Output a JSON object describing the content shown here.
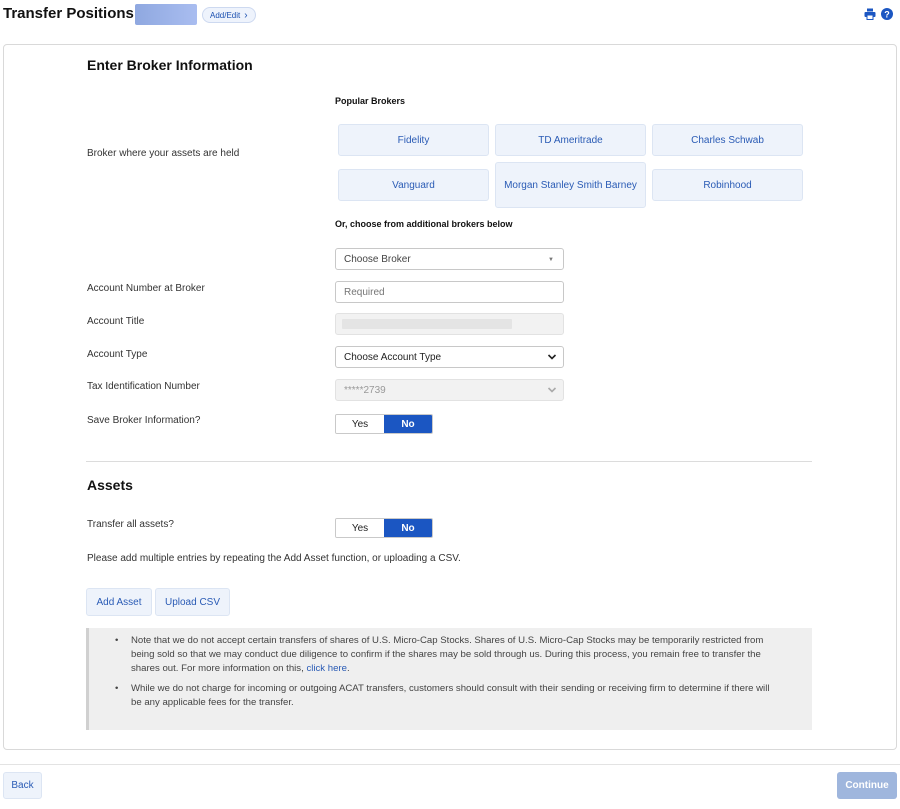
{
  "header": {
    "title": "Transfer Positions",
    "add_edit_label": "Add/Edit",
    "print_icon": "print-icon",
    "help_icon": "question-circle-icon"
  },
  "broker_section": {
    "heading": "Enter Broker Information",
    "popular_label": "Popular Brokers",
    "broker_label": "Broker where your assets are held",
    "brokers": [
      "Fidelity",
      "TD Ameritrade",
      "Charles Schwab",
      "Vanguard",
      "Morgan Stanley Smith Barney",
      "Robinhood"
    ],
    "additional_label": "Or, choose from additional brokers below",
    "choose_broker": "Choose Broker",
    "fields": {
      "account_number": {
        "label": "Account Number at Broker",
        "placeholder": "Required"
      },
      "account_title": {
        "label": "Account Title"
      },
      "account_type": {
        "label": "Account Type",
        "value": "Choose Account Type"
      },
      "tax_id": {
        "label": "Tax Identification Number",
        "value": "*****2739"
      }
    },
    "save_label": "Save Broker Information?",
    "save_toggle": {
      "yes": "Yes",
      "no": "No",
      "selected": "No"
    }
  },
  "assets_section": {
    "heading": "Assets",
    "transfer_all_label": "Transfer all assets?",
    "transfer_toggle": {
      "yes": "Yes",
      "no": "No",
      "selected": "No"
    },
    "instructions": "Please add multiple entries by repeating the Add Asset function, or uploading a CSV.",
    "add_asset": "Add Asset",
    "upload_csv": "Upload CSV",
    "notes": {
      "note1": "Note that we do not accept certain transfers of shares of U.S. Micro-Cap Stocks. Shares of U.S. Micro-Cap Stocks may be temporarily restricted from being sold so that we may conduct due diligence to confirm if the shares may be sold through us. During this process, you remain free to transfer the shares out. For more information on this, ",
      "note1_link": "click here",
      "note1_end": ".",
      "note2": "While we do not charge for incoming or outgoing ACAT transfers, customers should consult with their sending or receiving firm to determine if there will be any applicable fees for the transfer."
    }
  },
  "footer": {
    "back": "Back",
    "continue": "Continue"
  },
  "colors": {
    "accent": "#1b56c2",
    "link": "#2a5bb5",
    "button_bg": "#eef3fb",
    "disabled_continue": "#9fb6dd"
  }
}
